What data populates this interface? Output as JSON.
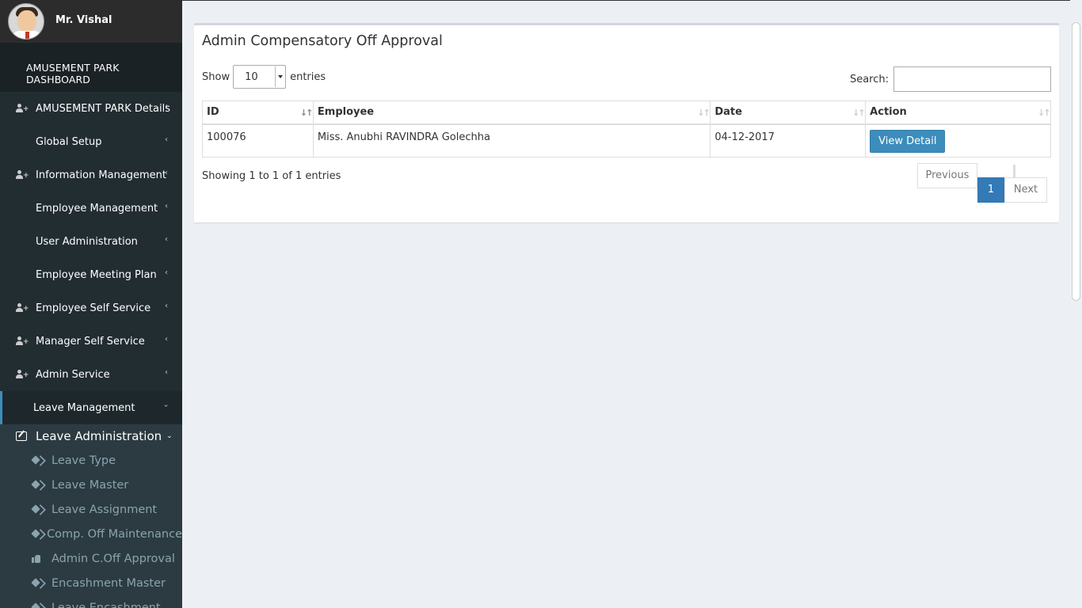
{
  "user": {
    "name": "Mr. Vishal"
  },
  "dashboard_title": "AMUSEMENT PARK DASHBOARD",
  "menu": [
    {
      "label": "AMUSEMENT PARK Details",
      "icon": "user-plus-icon"
    },
    {
      "label": "Global Setup",
      "icon": "grid-icon"
    },
    {
      "label": "Information Management",
      "icon": "user-plus-icon"
    },
    {
      "label": "Employee Management",
      "icon": "grid-icon"
    },
    {
      "label": "User Administration",
      "icon": "grid-icon"
    },
    {
      "label": "Employee Meeting Plan",
      "icon": "grid-icon"
    },
    {
      "label": "Employee Self Service",
      "icon": "user-plus-icon"
    },
    {
      "label": "Manager Self Service",
      "icon": "user-plus-icon"
    },
    {
      "label": "Admin Service",
      "icon": "user-plus-icon"
    },
    {
      "label": "Leave Management",
      "icon": "grid-icon",
      "active": true
    }
  ],
  "submenu": {
    "header": "Leave Administration",
    "items": [
      {
        "label": "Leave Type",
        "icon": "tags-icon"
      },
      {
        "label": "Leave Master",
        "icon": "tags-icon"
      },
      {
        "label": "Leave Assignment",
        "icon": "tags-icon"
      },
      {
        "label": "Comp. Off Maintenance",
        "icon": "tags-icon"
      },
      {
        "label": "Admin C.Off Approval",
        "icon": "thumbs-up-icon"
      },
      {
        "label": "Encashment Master",
        "icon": "tags-icon"
      },
      {
        "label": "Leave Encashment",
        "icon": "tags-icon"
      }
    ]
  },
  "main": {
    "title": "Admin Compensatory Off Approval",
    "show_label": "Show",
    "entries_value": "10",
    "entries_label": "entries",
    "search_label": "Search:",
    "search_value": "",
    "columns": [
      "ID",
      "Employee",
      "Date",
      "Action"
    ],
    "rows": [
      {
        "id": "100076",
        "employee": "Miss. Anubhi RAVINDRA Golechha",
        "date": "04-12-2017",
        "action": "View Detail"
      }
    ],
    "info": "Showing 1 to 1 of 1 entries",
    "pagination": {
      "previous": "Previous",
      "current": "1",
      "next": "Next"
    }
  },
  "colors": {
    "sidebar": "#222d32",
    "accent": "#3c8dbc",
    "page_bg": "#ecf0f5"
  }
}
